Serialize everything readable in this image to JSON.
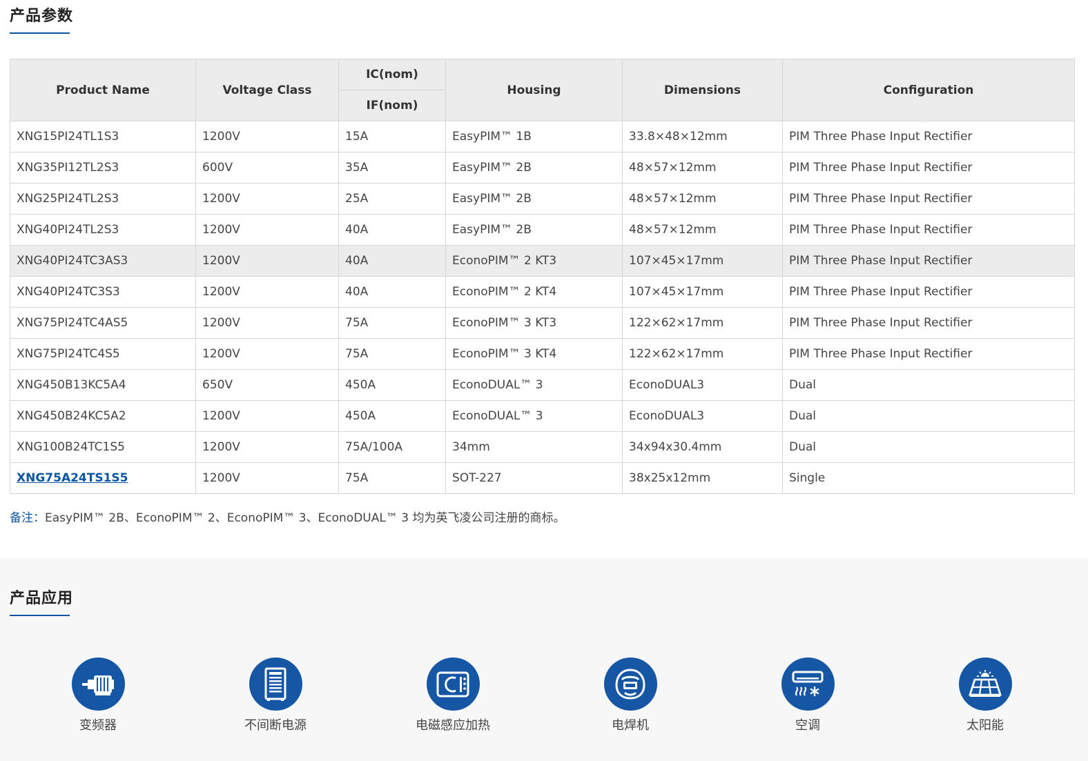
{
  "params": {
    "title": "产品参数",
    "headers": {
      "product_name": "Product Name",
      "voltage_class": "Voltage Class",
      "ic_nom": "IC(nom)",
      "if_nom": "IF(nom)",
      "housing": "Housing",
      "dimensions": "Dimensions",
      "configuration": "Configuration"
    },
    "rows": [
      {
        "name": "XNG15PI24TL1S3",
        "voltage": "1200V",
        "current": "15A",
        "housing": "EasyPIM™ 1B",
        "dimensions": "33.8×48×12mm",
        "config": "PIM Three Phase Input Rectifier"
      },
      {
        "name": "XNG35PI12TL2S3",
        "voltage": "600V",
        "current": "35A",
        "housing": "EasyPIM™ 2B",
        "dimensions": "48×57×12mm",
        "config": "PIM Three Phase Input Rectifier"
      },
      {
        "name": "XNG25PI24TL2S3",
        "voltage": "1200V",
        "current": "25A",
        "housing": "EasyPIM™ 2B",
        "dimensions": "48×57×12mm",
        "config": "PIM Three Phase Input Rectifier"
      },
      {
        "name": "XNG40PI24TL2S3",
        "voltage": "1200V",
        "current": "40A",
        "housing": "EasyPIM™ 2B",
        "dimensions": "48×57×12mm",
        "config": "PIM Three Phase Input Rectifier"
      },
      {
        "name": "XNG40PI24TC3AS3",
        "voltage": "1200V",
        "current": "40A",
        "housing": "EconoPIM™ 2 KT3",
        "dimensions": "107×45×17mm",
        "config": "PIM Three Phase Input Rectifier"
      },
      {
        "name": "XNG40PI24TC3S3",
        "voltage": "1200V",
        "current": "40A",
        "housing": "EconoPIM™ 2 KT4",
        "dimensions": "107×45×17mm",
        "config": "PIM Three Phase Input Rectifier"
      },
      {
        "name": "XNG75PI24TC4AS5",
        "voltage": "1200V",
        "current": "75A",
        "housing": "EconoPIM™ 3 KT3",
        "dimensions": "122×62×17mm",
        "config": "PIM Three Phase Input Rectifier"
      },
      {
        "name": "XNG75PI24TC4S5",
        "voltage": "1200V",
        "current": "75A",
        "housing": "EconoPIM™ 3 KT4",
        "dimensions": "122×62×17mm",
        "config": "PIM Three Phase Input Rectifier"
      },
      {
        "name": "XNG450B13KC5A4",
        "voltage": "650V",
        "current": "450A",
        "housing": "EconoDUAL™ 3",
        "dimensions": "EconoDUAL3",
        "config": "Dual"
      },
      {
        "name": "XNG450B24KC5A2",
        "voltage": "1200V",
        "current": "450A",
        "housing": "EconoDUAL™ 3",
        "dimensions": "EconoDUAL3",
        "config": "Dual"
      },
      {
        "name": "XNG100B24TC1S5",
        "voltage": "1200V",
        "current": "75A/100A",
        "housing": "34mm",
        "dimensions": "34x94x30.4mm",
        "config": "Dual"
      },
      {
        "name": "XNG75A24TS1S5",
        "voltage": "1200V",
        "current": "75A",
        "housing": "SOT-227",
        "dimensions": "38x25x12mm",
        "config": "Single"
      }
    ],
    "note_label": "备注：",
    "note_text": "EasyPIM™ 2B、EconoPIM™ 2、EconoPIM™ 3、EconoDUAL™ 3 均为英飞凌公司注册的商标。"
  },
  "applications": {
    "title": "产品应用",
    "items": [
      {
        "label": "变频器",
        "icon": "motor-icon"
      },
      {
        "label": "不间断电源",
        "icon": "ups-cabinet-icon"
      },
      {
        "label": "电磁感应加热",
        "icon": "induction-cooker-icon"
      },
      {
        "label": "电焊机",
        "icon": "welding-helmet-icon"
      },
      {
        "label": "空调",
        "icon": "air-conditioner-icon"
      },
      {
        "label": "太阳能",
        "icon": "solar-panel-icon"
      }
    ]
  },
  "colors": {
    "accent": "#0b55a3",
    "icon_circle": "#1557a5",
    "header_bg": "#ececec",
    "app_section_bg": "#f7f7f7"
  }
}
